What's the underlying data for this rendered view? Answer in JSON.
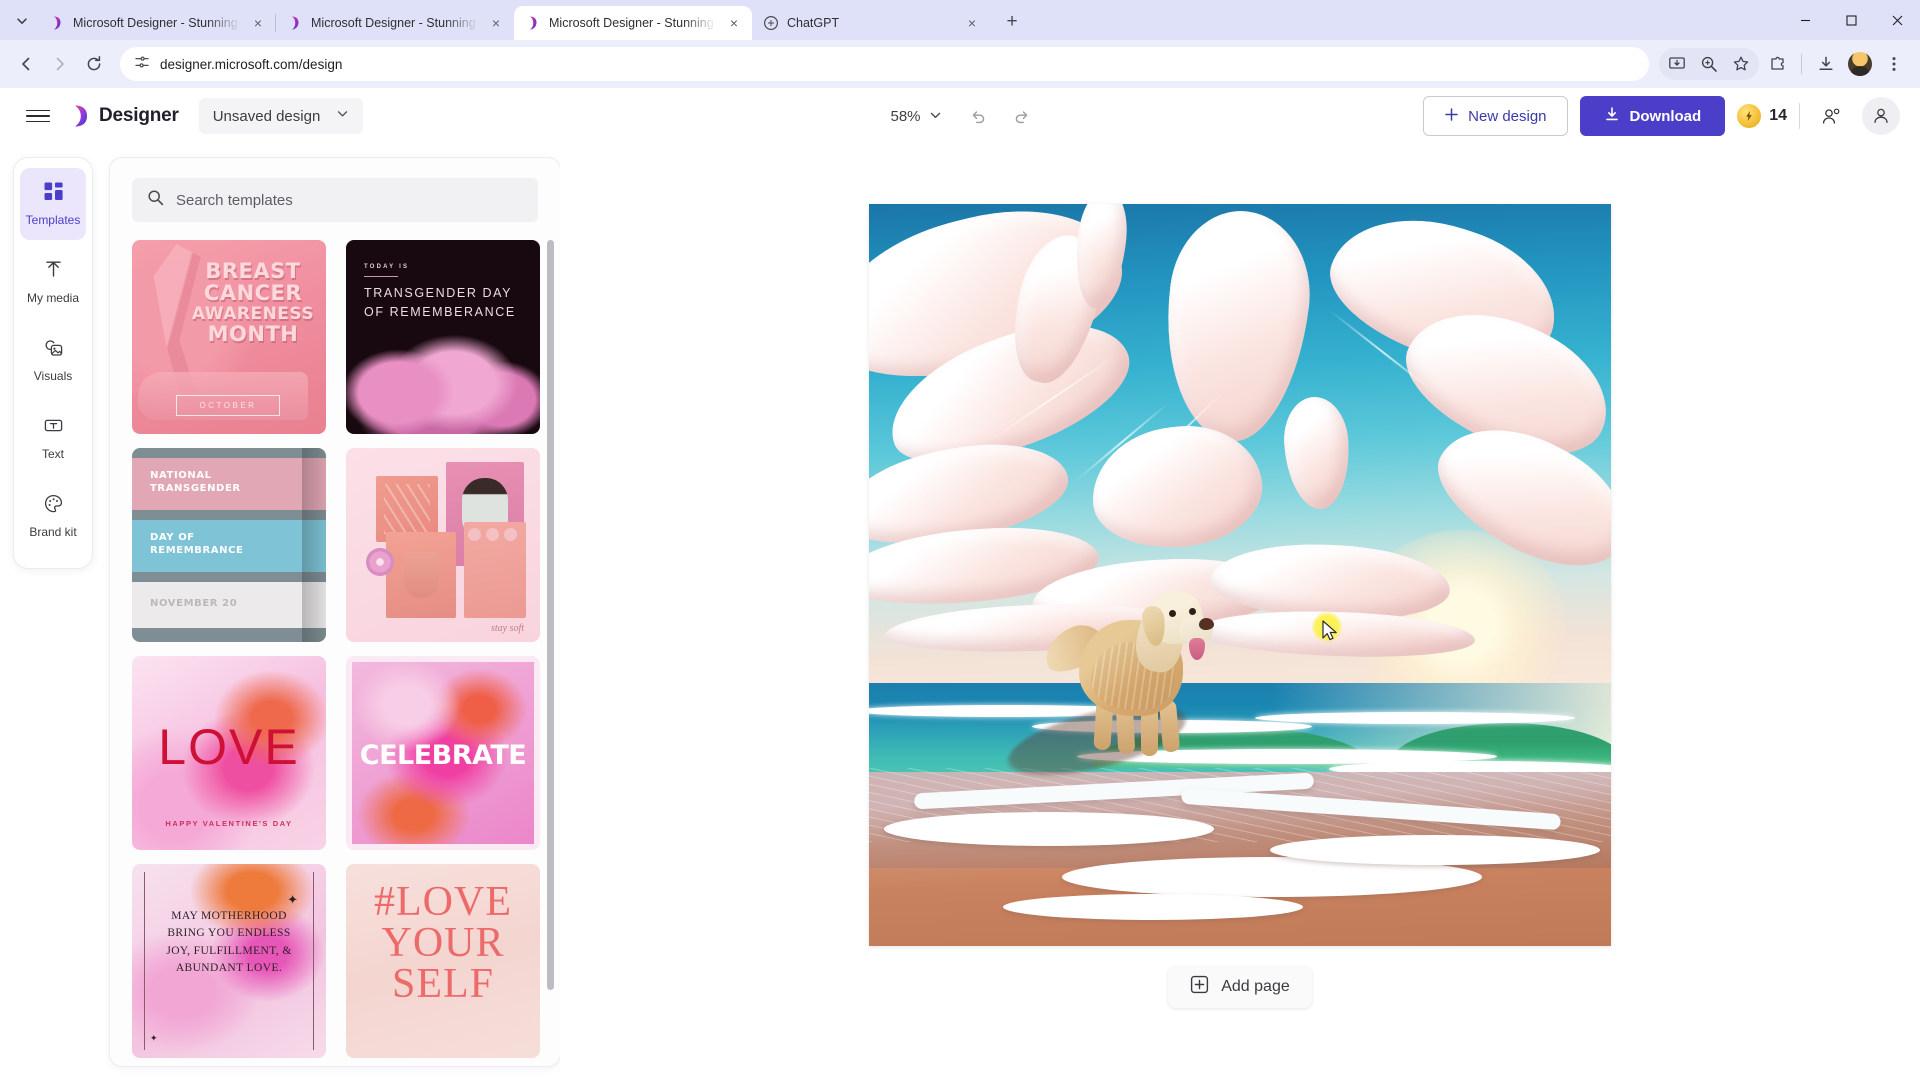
{
  "browser": {
    "tab_list_icon": "chevron-down-icon",
    "tabs": [
      {
        "title": "Microsoft Designer - Stunning d",
        "favicon": "designer-favicon",
        "active": false,
        "close": "×"
      },
      {
        "title": "Microsoft Designer - Stunning d",
        "favicon": "designer-favicon",
        "active": false,
        "close": "×"
      },
      {
        "title": "Microsoft Designer - Stunning d",
        "favicon": "designer-favicon",
        "active": true,
        "close": "×"
      },
      {
        "title": "ChatGPT",
        "favicon": "chatgpt-favicon",
        "active": false,
        "close": "×"
      }
    ],
    "new_tab_label": "+",
    "window_controls": {
      "minimize": "—",
      "maximize": "□",
      "close": "×"
    },
    "nav": {
      "back": "←",
      "forward": "→",
      "reload": "⟳"
    },
    "omnibox": {
      "site_info_icon": "tune-icon",
      "url": "designer.microsoft.com/design"
    },
    "toolbar_right_icons": [
      "install-app-icon",
      "zoom-icon",
      "bookmark-star-icon",
      "extensions-puzzle-icon",
      "downloads-icon",
      "profile-avatar-icon",
      "more-menu-icon"
    ]
  },
  "app_header": {
    "menu_icon": "hamburger-icon",
    "brand": "Designer",
    "document_name": "Unsaved design",
    "document_chevron": "chevron-down-icon",
    "zoom_level": "58%",
    "zoom_chevron": "chevron-down-icon",
    "undo_icon": "undo-icon",
    "redo_icon": "redo-icon",
    "new_design_label": "New design",
    "new_design_icon": "plus-icon",
    "download_label": "Download",
    "download_icon": "download-arrow-icon",
    "credits_value": "14",
    "credits_icon": "lightning-coin-icon",
    "share_icon": "share-people-icon",
    "account_icon": "person-icon"
  },
  "sidebar": {
    "items": [
      {
        "label": "Templates",
        "icon": "grid-squares-icon",
        "active": true
      },
      {
        "label": "My media",
        "icon": "upload-arrow-icon",
        "active": false
      },
      {
        "label": "Visuals",
        "icon": "image-shapes-icon",
        "active": false
      },
      {
        "label": "Text",
        "icon": "text-box-icon",
        "active": false
      },
      {
        "label": "Brand kit",
        "icon": "palette-icon",
        "active": false
      }
    ]
  },
  "templates_panel": {
    "search_placeholder": "Search templates",
    "search_value": "",
    "search_icon": "search-icon",
    "items": [
      {
        "id": "breast-cancer-awareness-month",
        "title_lines": [
          "BREAST",
          "CANCER",
          "AWARENESS",
          "MONTH"
        ],
        "badge": "OCTOBER"
      },
      {
        "id": "transgender-day-of-rememberance",
        "kicker": "TODAY IS",
        "title": "TRANSGENDER DAY OF REMEMBERANCE"
      },
      {
        "id": "national-transgender-day-of-remembrance",
        "line1": "NATIONAL TRANSGENDER",
        "line2": "DAY OF REMEMBRANCE",
        "line3": "NOVEMBER 20"
      },
      {
        "id": "stay-soft-moodboard",
        "caption": "stay soft"
      },
      {
        "id": "love-valentines",
        "title": "LOVE",
        "subtitle": "HAPPY VALENTINE'S DAY"
      },
      {
        "id": "celebrate",
        "title": "CELEBRATE"
      },
      {
        "id": "may-motherhood",
        "text": "MAY MOTHERHOOD BRING YOU ENDLESS JOY, FULFILLMENT, & ABUNDANT LOVE."
      },
      {
        "id": "love-yourself",
        "title_lines": [
          "#LOVE",
          "YOUR",
          "SELF"
        ]
      }
    ]
  },
  "canvas": {
    "artwork_description": "Golden retriever dog standing on a sunset beach with stylized swirling pink clouds, turquoise ocean waves and sea foam on orange sand",
    "add_page_label": "Add page",
    "add_page_icon": "plus-square-icon"
  }
}
